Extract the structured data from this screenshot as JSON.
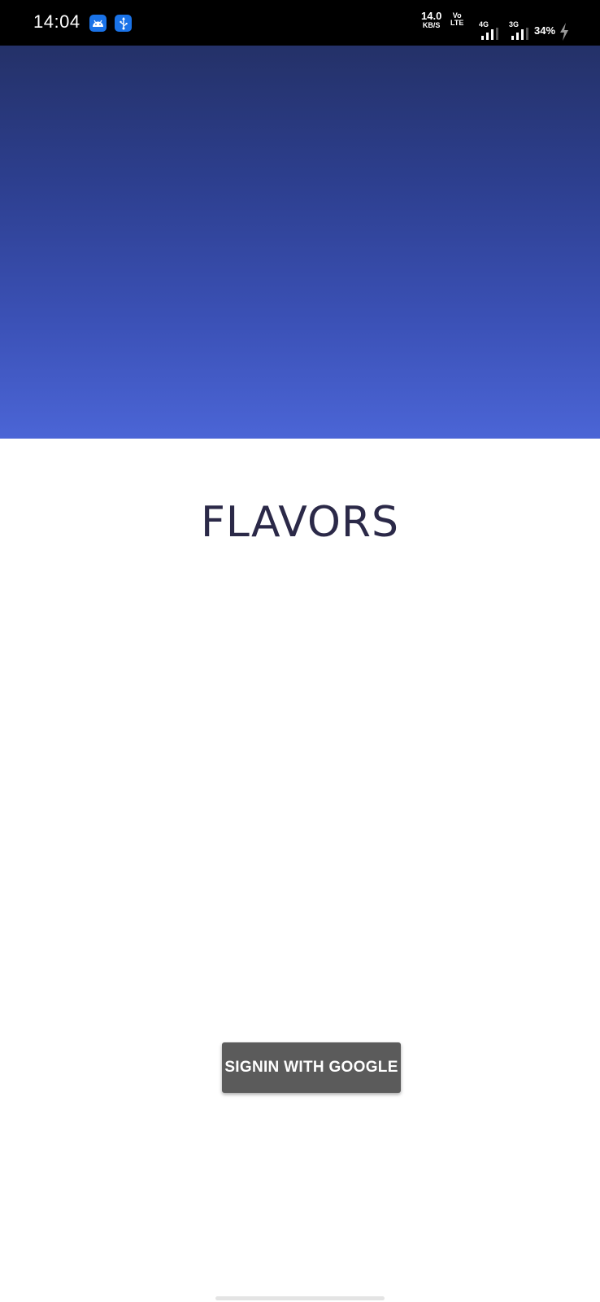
{
  "status_bar": {
    "time": "14:04",
    "notifications": [
      "android-icon",
      "usb-icon"
    ],
    "net_speed_value": "14.0",
    "net_speed_unit": "KB/S",
    "volte_top": "Vo",
    "volte_bottom": "LTE",
    "sim1_network": "4G",
    "sim2_network": "3G",
    "battery": "34%",
    "charging": true
  },
  "app": {
    "title": "FLAVORS",
    "signin_label": "SIGNIN WITH GOOGLE"
  },
  "colors": {
    "status_bar_bg": "#000000",
    "gradient_top": "#243168",
    "gradient_bottom": "#4b65d6",
    "title_color": "#2b2948",
    "button_bg": "#5b5b5b",
    "notif_icon_bg": "#1a73e8"
  }
}
